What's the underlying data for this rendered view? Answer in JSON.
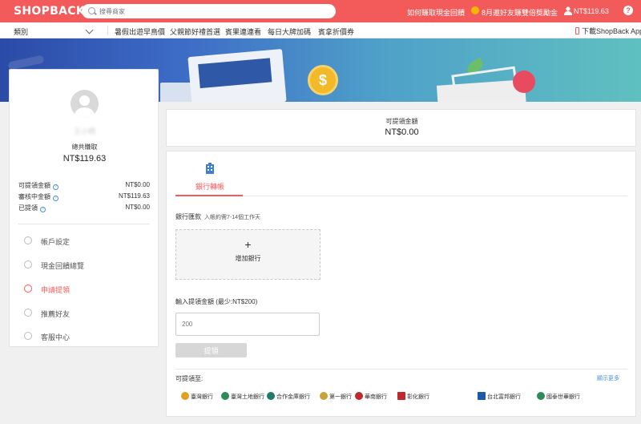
{
  "header": {
    "logo": "SHOPBACK",
    "search_placeholder": "搜尋商家",
    "links": [
      "如何賺取現金回饋",
      "8月邀好友賺雙倍獎勵金"
    ],
    "balance": "NT$119.63",
    "help": "?"
  },
  "nav": {
    "category_label": "類別",
    "items": [
      "暑假出遊早鳥價",
      "父親節好禮首選",
      "賓果連連看",
      "每日大牌加碼",
      "賓拿折價券"
    ],
    "app_link": "下載ShopBack App"
  },
  "banner": {
    "coin": "$"
  },
  "sidebar": {
    "username": "王小明",
    "total_label": "總共賺取",
    "total_value": "NT$119.63",
    "balances": [
      {
        "label": "可提領金額",
        "value": "NT$0.00"
      },
      {
        "label": "審核中金額",
        "value": "NT$119.63"
      },
      {
        "label": "已提領",
        "value": "NT$0.00"
      }
    ],
    "menu": [
      {
        "label": "帳戶設定",
        "icon": "gear-icon"
      },
      {
        "label": "現金回饋總覽",
        "icon": "chart-icon"
      },
      {
        "label": "申請提領",
        "icon": "withdraw-icon"
      },
      {
        "label": "推薦好友",
        "icon": "friends-icon"
      },
      {
        "label": "客服中心",
        "icon": "question-icon"
      }
    ],
    "active_index": 2
  },
  "available": {
    "label": "可提領金額",
    "value": "NT$0.00"
  },
  "withdraw": {
    "tab_label": "銀行轉帳",
    "transfer_label": "銀行匯款",
    "transfer_sub": "入帳約需7-14個工作天",
    "add_plus": "+",
    "add_bank_label": "增加銀行",
    "amount_label": "輸入提領金額 (最少:NT$200)",
    "amount_placeholder": "200",
    "submit_label": "提領",
    "banks_label": "可提領至:",
    "banks_more": "顯示更多",
    "banks": [
      {
        "name": "臺灣銀行",
        "color": "#e0a020"
      },
      {
        "name": "臺灣土地銀行",
        "color": "#2e8b57"
      },
      {
        "name": "合作金庫銀行",
        "color": "#1e7a6a"
      },
      {
        "name": "第一銀行",
        "color": "#caa23a"
      },
      {
        "name": "華南銀行",
        "color": "#c0282f"
      },
      {
        "name": "彰化銀行",
        "color": "#c0282f"
      },
      {
        "name": "台北富邦銀行",
        "color": "#1a5aa8"
      },
      {
        "name": "國泰世華銀行",
        "color": "#2e8b57"
      }
    ]
  }
}
